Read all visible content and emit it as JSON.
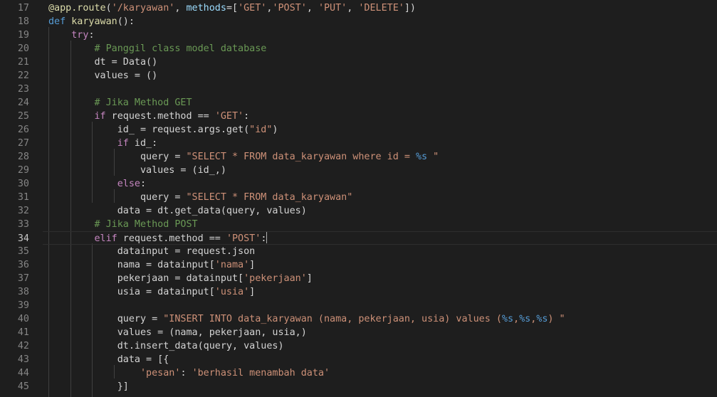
{
  "theme": {
    "background": "#1e1e1e",
    "text": "#d4d4d4",
    "line_number": "#858585",
    "keyword": "#c586c0",
    "storage": "#569cd6",
    "function": "#dcdcaa",
    "string": "#ce9178",
    "comment": "#6a9955"
  },
  "editor": {
    "active_line": 34,
    "lines": [
      {
        "number": "17",
        "tokens": [
          {
            "t": "function",
            "v": "@app.route"
          },
          {
            "t": "plain",
            "v": "("
          },
          {
            "t": "string",
            "v": "'/karyawan'"
          },
          {
            "t": "plain",
            "v": ", "
          },
          {
            "t": "variable",
            "v": "methods"
          },
          {
            "t": "plain",
            "v": "=["
          },
          {
            "t": "string",
            "v": "'GET'"
          },
          {
            "t": "plain",
            "v": ","
          },
          {
            "t": "string",
            "v": "'POST'"
          },
          {
            "t": "plain",
            "v": ", "
          },
          {
            "t": "string",
            "v": "'PUT'"
          },
          {
            "t": "plain",
            "v": ", "
          },
          {
            "t": "string",
            "v": "'DELETE'"
          },
          {
            "t": "plain",
            "v": "])"
          }
        ]
      },
      {
        "number": "18",
        "tokens": [
          {
            "t": "storage",
            "v": "def"
          },
          {
            "t": "plain",
            "v": " "
          },
          {
            "t": "function",
            "v": "karyawan"
          },
          {
            "t": "plain",
            "v": "():"
          }
        ]
      },
      {
        "number": "19",
        "tokens": [
          {
            "t": "plain",
            "v": "    "
          },
          {
            "t": "keyword",
            "v": "try"
          },
          {
            "t": "plain",
            "v": ":"
          }
        ]
      },
      {
        "number": "20",
        "tokens": [
          {
            "t": "plain",
            "v": "        "
          },
          {
            "t": "comment",
            "v": "# Panggil class model database"
          }
        ]
      },
      {
        "number": "21",
        "tokens": [
          {
            "t": "plain",
            "v": "        dt = Data()"
          }
        ]
      },
      {
        "number": "22",
        "tokens": [
          {
            "t": "plain",
            "v": "        values = ()"
          }
        ]
      },
      {
        "number": "23",
        "tokens": []
      },
      {
        "number": "24",
        "tokens": [
          {
            "t": "plain",
            "v": "        "
          },
          {
            "t": "comment",
            "v": "# Jika Method GET"
          }
        ]
      },
      {
        "number": "25",
        "tokens": [
          {
            "t": "plain",
            "v": "        "
          },
          {
            "t": "keyword",
            "v": "if"
          },
          {
            "t": "plain",
            "v": " request.method == "
          },
          {
            "t": "string",
            "v": "'GET'"
          },
          {
            "t": "plain",
            "v": ":"
          }
        ]
      },
      {
        "number": "26",
        "tokens": [
          {
            "t": "plain",
            "v": "            id_ = request.args.get("
          },
          {
            "t": "string",
            "v": "\"id\""
          },
          {
            "t": "plain",
            "v": ")"
          }
        ]
      },
      {
        "number": "27",
        "tokens": [
          {
            "t": "plain",
            "v": "            "
          },
          {
            "t": "keyword",
            "v": "if"
          },
          {
            "t": "plain",
            "v": " id_:"
          }
        ]
      },
      {
        "number": "28",
        "tokens": [
          {
            "t": "plain",
            "v": "                query = "
          },
          {
            "t": "string",
            "v": "\"SELECT * FROM data_karyawan where id = "
          },
          {
            "t": "placeholder",
            "v": "%s"
          },
          {
            "t": "string",
            "v": " \""
          }
        ]
      },
      {
        "number": "29",
        "tokens": [
          {
            "t": "plain",
            "v": "                values = (id_,)"
          }
        ]
      },
      {
        "number": "30",
        "tokens": [
          {
            "t": "plain",
            "v": "            "
          },
          {
            "t": "keyword",
            "v": "else"
          },
          {
            "t": "plain",
            "v": ":"
          }
        ]
      },
      {
        "number": "31",
        "tokens": [
          {
            "t": "plain",
            "v": "                query = "
          },
          {
            "t": "string",
            "v": "\"SELECT * FROM data_karyawan\""
          }
        ]
      },
      {
        "number": "32",
        "tokens": [
          {
            "t": "plain",
            "v": "            data = dt.get_data(query, values)"
          }
        ]
      },
      {
        "number": "33",
        "tokens": [
          {
            "t": "plain",
            "v": "        "
          },
          {
            "t": "comment",
            "v": "# Jika Method POST"
          }
        ]
      },
      {
        "number": "34",
        "tokens": [
          {
            "t": "plain",
            "v": "        "
          },
          {
            "t": "keyword",
            "v": "elif"
          },
          {
            "t": "plain",
            "v": " request.method == "
          },
          {
            "t": "string",
            "v": "'POST'"
          },
          {
            "t": "plain",
            "v": ":"
          }
        ]
      },
      {
        "number": "35",
        "tokens": [
          {
            "t": "plain",
            "v": "            datainput = request.json"
          }
        ]
      },
      {
        "number": "36",
        "tokens": [
          {
            "t": "plain",
            "v": "            nama = datainput["
          },
          {
            "t": "string",
            "v": "'nama'"
          },
          {
            "t": "plain",
            "v": "]"
          }
        ]
      },
      {
        "number": "37",
        "tokens": [
          {
            "t": "plain",
            "v": "            pekerjaan = datainput["
          },
          {
            "t": "string",
            "v": "'pekerjaan'"
          },
          {
            "t": "plain",
            "v": "]"
          }
        ]
      },
      {
        "number": "38",
        "tokens": [
          {
            "t": "plain",
            "v": "            usia = datainput["
          },
          {
            "t": "string",
            "v": "'usia'"
          },
          {
            "t": "plain",
            "v": "]"
          }
        ]
      },
      {
        "number": "39",
        "tokens": []
      },
      {
        "number": "40",
        "tokens": [
          {
            "t": "plain",
            "v": "            query = "
          },
          {
            "t": "string",
            "v": "\"INSERT INTO data_karyawan (nama, pekerjaan, usia) values ("
          },
          {
            "t": "placeholder",
            "v": "%s"
          },
          {
            "t": "string",
            "v": ","
          },
          {
            "t": "placeholder",
            "v": "%s"
          },
          {
            "t": "string",
            "v": ","
          },
          {
            "t": "placeholder",
            "v": "%s"
          },
          {
            "t": "string",
            "v": ") \""
          }
        ]
      },
      {
        "number": "41",
        "tokens": [
          {
            "t": "plain",
            "v": "            values = (nama, pekerjaan, usia,)"
          }
        ]
      },
      {
        "number": "42",
        "tokens": [
          {
            "t": "plain",
            "v": "            dt.insert_data(query, values)"
          }
        ]
      },
      {
        "number": "43",
        "tokens": [
          {
            "t": "plain",
            "v": "            data = [{"
          }
        ]
      },
      {
        "number": "44",
        "tokens": [
          {
            "t": "plain",
            "v": "                "
          },
          {
            "t": "string",
            "v": "'pesan'"
          },
          {
            "t": "plain",
            "v": ": "
          },
          {
            "t": "string",
            "v": "'berhasil menambah data'"
          }
        ]
      },
      {
        "number": "45",
        "tokens": [
          {
            "t": "plain",
            "v": "            }]"
          }
        ]
      }
    ]
  }
}
